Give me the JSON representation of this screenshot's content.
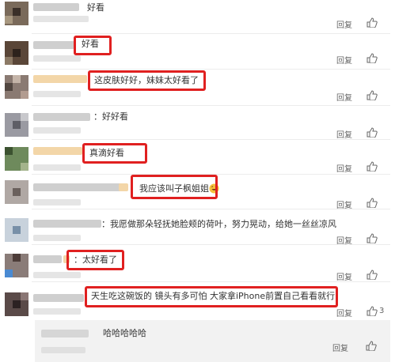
{
  "comments": [
    {
      "text": "好看",
      "reply": "回复",
      "likes": ""
    },
    {
      "text": "好看",
      "reply": "回复",
      "likes": ""
    },
    {
      "text": "这皮肤好好，妹妹太好看了",
      "reply": "回复",
      "likes": ""
    },
    {
      "text": "：好好看",
      "reply": "回复",
      "likes": ""
    },
    {
      "text": "真滴好看",
      "reply": "回复",
      "likes": ""
    },
    {
      "text": "我应该叫子枫姐姐",
      "reply": "回复",
      "likes": ""
    },
    {
      "text": "：我愿做那朵轻抚她脸颊的荷叶，努力晃动，给她一丝丝凉风",
      "reply": "回复",
      "likes": ""
    },
    {
      "text": "：太好看了",
      "reply": "回复",
      "likes": ""
    },
    {
      "text": "天生吃这碗饭的 镜头有多可怕 大家拿iPhone前置自己看看就行",
      "reply": "回复",
      "likes": "3"
    }
  ],
  "subreply": {
    "text": "哈哈哈哈哈",
    "reply": "回复",
    "likes": ""
  },
  "icons": {
    "like": "thumbs-up-icon",
    "emoji": "laughing-emoji-icon"
  },
  "colors": {
    "highlight": "#e02020",
    "link_gray": "#666666",
    "subreply_bg": "#f2f2f2"
  }
}
